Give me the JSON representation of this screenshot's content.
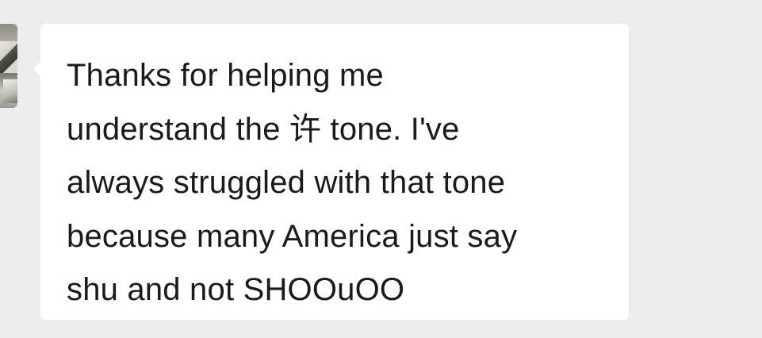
{
  "message": {
    "sender_avatar": "contact-avatar",
    "text": "Thanks for helping me\nunderstand the 许 tone. I've\nalways struggled with that tone\nbecause many America just say\nshu and not SHOOuOO"
  },
  "colors": {
    "background": "#ececec",
    "bubble": "#ffffff",
    "text": "#1a1a1a"
  }
}
